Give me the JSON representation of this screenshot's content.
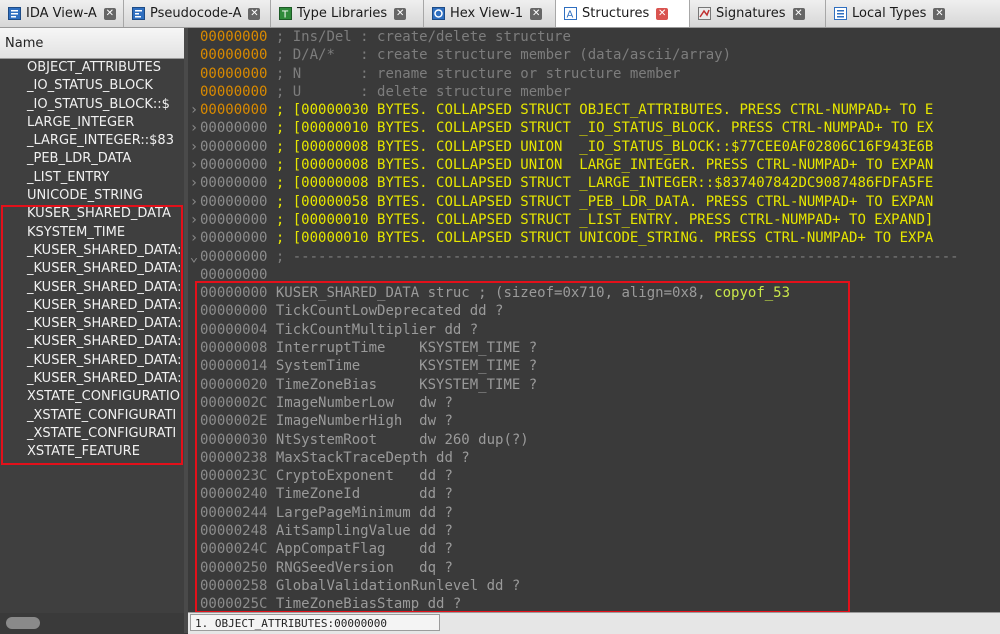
{
  "tabs": [
    {
      "label": "IDA View-A",
      "icon": "ida-view-icon"
    },
    {
      "label": "Pseudocode-A",
      "icon": "pseudocode-icon"
    },
    {
      "label": "Type Libraries",
      "icon": "type-libraries-icon"
    },
    {
      "label": "Hex View-1",
      "icon": "hex-view-icon"
    },
    {
      "label": "Structures",
      "icon": "structures-icon",
      "active": true
    },
    {
      "label": "Signatures",
      "icon": "signatures-icon"
    },
    {
      "label": "Local Types",
      "icon": "local-types-icon"
    }
  ],
  "left_panel": {
    "header": "Name",
    "items": [
      "OBJECT_ATTRIBUTES",
      "_IO_STATUS_BLOCK",
      "_IO_STATUS_BLOCK::$",
      "LARGE_INTEGER",
      "_LARGE_INTEGER::$83",
      "_PEB_LDR_DATA",
      "_LIST_ENTRY",
      "UNICODE_STRING",
      "KUSER_SHARED_DATA",
      "KSYSTEM_TIME",
      "_KUSER_SHARED_DATA:",
      "_KUSER_SHARED_DATA:",
      "_KUSER_SHARED_DATA:",
      "_KUSER_SHARED_DATA:",
      "_KUSER_SHARED_DATA:",
      "_KUSER_SHARED_DATA:",
      "_KUSER_SHARED_DATA:",
      "_KUSER_SHARED_DATA:",
      "XSTATE_CONFIGURATIO",
      "_XSTATE_CONFIGURATI",
      "_XSTATE_CONFIGURATI",
      "XSTATE_FEATURE"
    ]
  },
  "help_lines": [
    {
      "addr": "00000000",
      "text": " ; Ins/Del : create/delete structure"
    },
    {
      "addr": "00000000",
      "text": " ; D/A/*   : create structure member (data/ascii/array)"
    },
    {
      "addr": "00000000",
      "text": " ; N       : rename structure or structure member"
    },
    {
      "addr": "00000000",
      "text": " ; U       : delete structure member"
    }
  ],
  "collapsed_lines": [
    {
      "addr": "00000000",
      "text": " ; [00000030 BYTES. COLLAPSED STRUCT OBJECT_ATTRIBUTES. PRESS CTRL-NUMPAD+ TO E"
    },
    {
      "addr": "00000000",
      "text": " ; [00000010 BYTES. COLLAPSED STRUCT _IO_STATUS_BLOCK. PRESS CTRL-NUMPAD+ TO EX"
    },
    {
      "addr": "00000000",
      "text": " ; [00000008 BYTES. COLLAPSED UNION  _IO_STATUS_BLOCK::$77CEE0AF02806C16F943E6B"
    },
    {
      "addr": "00000000",
      "text": " ; [00000008 BYTES. COLLAPSED UNION  LARGE_INTEGER. PRESS CTRL-NUMPAD+ TO EXPAN"
    },
    {
      "addr": "00000000",
      "text": " ; [00000008 BYTES. COLLAPSED STRUCT _LARGE_INTEGER::$837407842DC9087486FDFA5FE"
    },
    {
      "addr": "00000000",
      "text": " ; [00000058 BYTES. COLLAPSED STRUCT _PEB_LDR_DATA. PRESS CTRL-NUMPAD+ TO EXPAN"
    },
    {
      "addr": "00000000",
      "text": " ; [00000010 BYTES. COLLAPSED STRUCT _LIST_ENTRY. PRESS CTRL-NUMPAD+ TO EXPAND]"
    },
    {
      "addr": "00000000",
      "text": " ; [00000010 BYTES. COLLAPSED STRUCT UNICODE_STRING. PRESS CTRL-NUMPAD+ TO EXPA"
    }
  ],
  "separator_line": {
    "addr": "00000000",
    "text": " ; -------------------------------------------------------------------------------"
  },
  "blank_line": {
    "addr": "00000000"
  },
  "struct_header": {
    "addr": "00000000",
    "text": " KUSER_SHARED_DATA struc ; (sizeof=0x710, align=0x8, ",
    "link": "copyof_53"
  },
  "members": [
    {
      "addr": "00000000",
      "text": " TickCountLowDeprecated dd ?"
    },
    {
      "addr": "00000004",
      "text": " TickCountMultiplier dd ?"
    },
    {
      "addr": "00000008",
      "text": " InterruptTime    KSYSTEM_TIME ?"
    },
    {
      "addr": "00000014",
      "text": " SystemTime       KSYSTEM_TIME ?"
    },
    {
      "addr": "00000020",
      "text": " TimeZoneBias     KSYSTEM_TIME ?"
    },
    {
      "addr": "0000002C",
      "text": " ImageNumberLow   dw ?"
    },
    {
      "addr": "0000002E",
      "text": " ImageNumberHigh  dw ?"
    },
    {
      "addr": "00000030",
      "text": " NtSystemRoot     dw 260 dup(?)"
    },
    {
      "addr": "00000238",
      "text": " MaxStackTraceDepth dd ?"
    },
    {
      "addr": "0000023C",
      "text": " CryptoExponent   dd ?"
    },
    {
      "addr": "00000240",
      "text": " TimeZoneId       dd ?"
    },
    {
      "addr": "00000244",
      "text": " LargePageMinimum dd ?"
    },
    {
      "addr": "00000248",
      "text": " AitSamplingValue dd ?"
    },
    {
      "addr": "0000024C",
      "text": " AppCompatFlag    dd ?"
    },
    {
      "addr": "00000250",
      "text": " RNGSeedVersion   dq ?"
    },
    {
      "addr": "00000258",
      "text": " GlobalValidationRunlevel dd ?"
    },
    {
      "addr": "0000025C",
      "text": " TimeZoneBiasStamp dd ?"
    }
  ],
  "status": {
    "text": "1. OBJECT_ATTRIBUTES:00000000"
  },
  "colors": {
    "highlight_box": "#e3101a",
    "collapsed_text": "#e6e600",
    "address_orange": "#d98a00",
    "address_gray": "#8c8c8c"
  }
}
